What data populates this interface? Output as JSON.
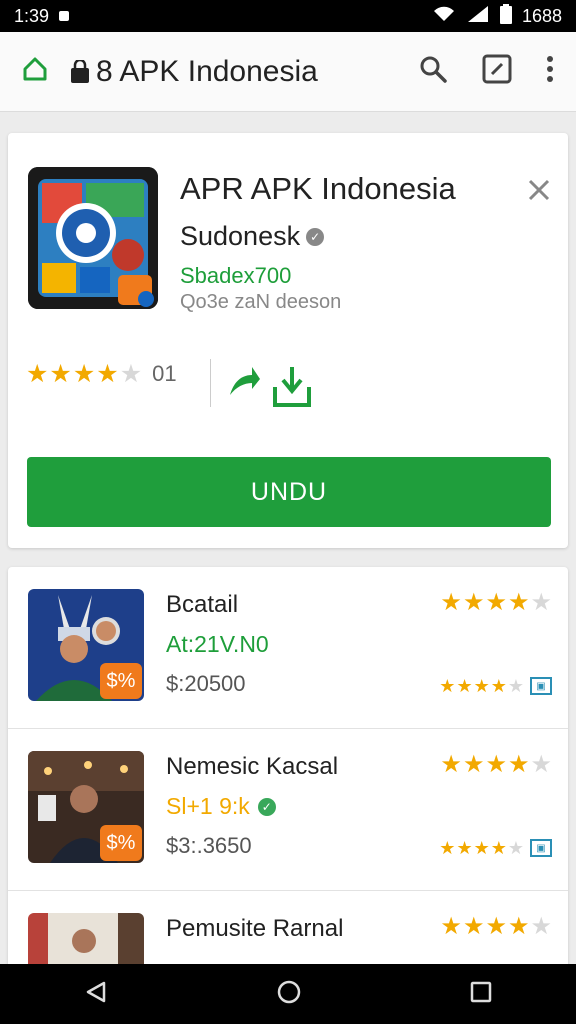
{
  "status": {
    "time": "1:39",
    "right_text": "1688"
  },
  "appbar": {
    "title": "8 APK Indonesia",
    "home_icon": "home-icon",
    "search_icon": "search-icon",
    "edit_icon": "edit-icon",
    "menu_icon": "more-vert-icon"
  },
  "app": {
    "name": "APR APK Indonesia",
    "developer": "Sudonesk",
    "price_line": "Sbadex700",
    "meta_line": "Qo3e zaN deeson",
    "rating": 4,
    "rating_count": "01",
    "install_label": "UNDU",
    "accent": "#1f9e3c",
    "star_color": "#f2a900"
  },
  "list": [
    {
      "title": "Bcatail",
      "subtitle": "At:21V.N0",
      "subtitle_color": "green",
      "price": "$:20500",
      "stars": 4,
      "badge": "$%",
      "verified": false
    },
    {
      "title": "Nemesic Kacsal",
      "subtitle": "Sl+1 9:k",
      "subtitle_color": "orange",
      "price": "$3:.3650",
      "stars": 4,
      "badge": "$%",
      "verified": true
    },
    {
      "title": "Pemusite Rarnal",
      "subtitle": "",
      "subtitle_color": "green",
      "price": "",
      "stars": 4,
      "badge": "",
      "verified": false
    }
  ],
  "nav": {
    "back_icon": "back-icon",
    "home_icon": "home-circle-icon",
    "recents_icon": "recents-icon"
  }
}
